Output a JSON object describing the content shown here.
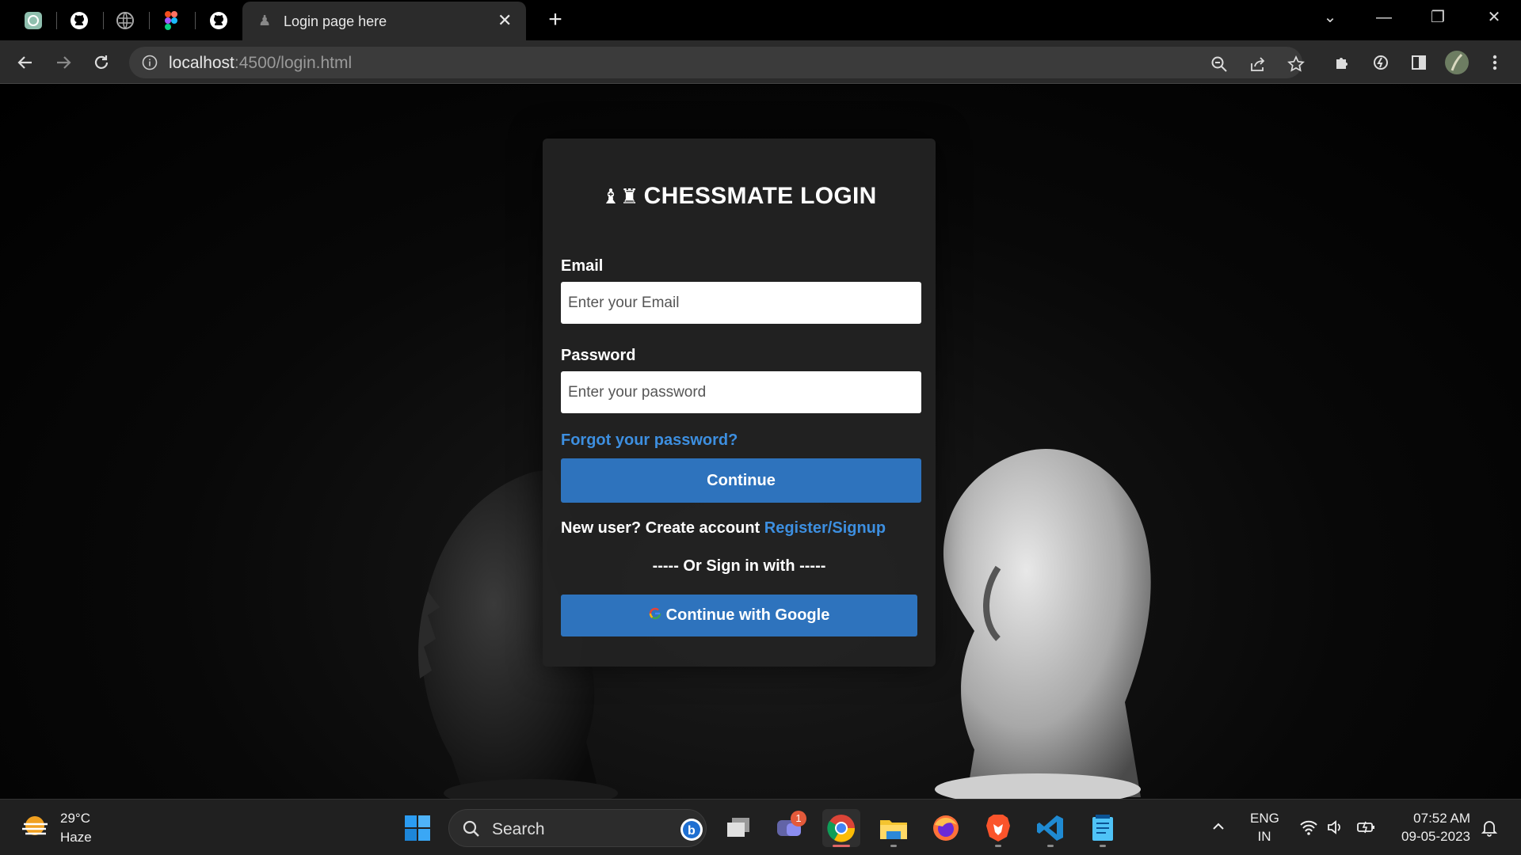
{
  "browser": {
    "tab_title": "Login page here",
    "url_host": "localhost",
    "url_rest": ":4500/login.html",
    "pinned_tabs": [
      "chatgpt-icon",
      "github-icon",
      "globe-icon",
      "figma-icon",
      "github-icon"
    ]
  },
  "login": {
    "title": "CHESSMATE LOGIN",
    "crown_glyph": "♝♜",
    "email_label": "Email",
    "email_placeholder": "Enter your Email",
    "password_label": "Password",
    "password_placeholder": "Enter your password",
    "forgot_link": "Forgot your password?",
    "continue_label": "Continue",
    "new_user_text": "New user? Create account",
    "register_link": "Register/Signup",
    "or_separator": "----- Or Sign in with -----",
    "google_label": "Continue with Google",
    "google_glyph": "G"
  },
  "taskbar": {
    "weather_temp": "29°C",
    "weather_desc": "Haze",
    "search_label": "Search",
    "chat_badge": "1",
    "lang_top": "ENG",
    "lang_bottom": "IN",
    "time": "07:52 AM",
    "date": "09-05-2023"
  },
  "colors": {
    "accent_button": "#2e73bd",
    "link": "#3d8fe0",
    "card_bg": "#222222"
  }
}
